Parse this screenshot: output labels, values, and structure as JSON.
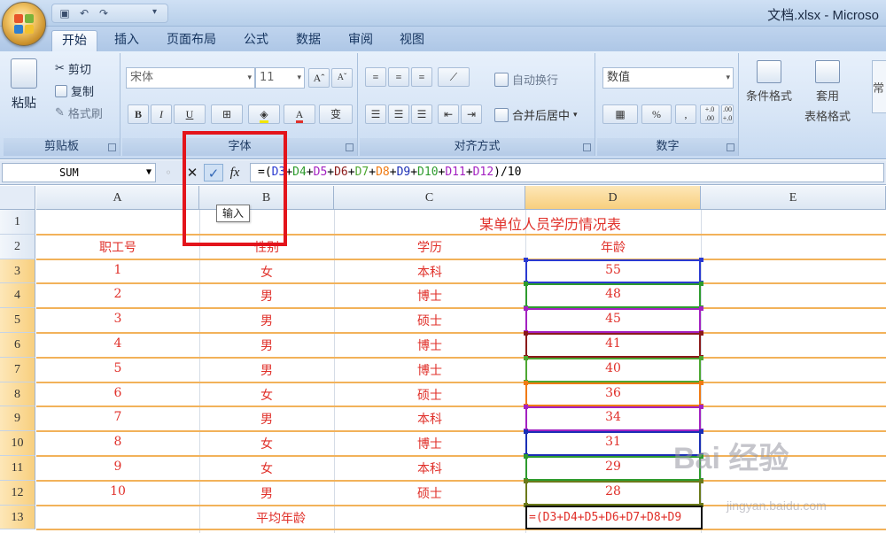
{
  "window": {
    "title": "文档.xlsx - Microso"
  },
  "tabs": [
    "开始",
    "插入",
    "页面布局",
    "公式",
    "数据",
    "审阅",
    "视图"
  ],
  "clipboard": {
    "paste": "粘贴",
    "cut": "剪切",
    "copy": "复制",
    "format_painter": "格式刷",
    "label": "剪贴板"
  },
  "font": {
    "name": "宋体",
    "size": "11",
    "grow": "A",
    "shrink": "A",
    "bold": "B",
    "italic": "I",
    "underline": "U",
    "label": "字体",
    "phonetic": "变"
  },
  "alignment": {
    "wrap": "自动换行",
    "merge": "合并后居中",
    "label": "对齐方式"
  },
  "number": {
    "format": "数值",
    "percent": "%",
    "comma": ",",
    "inc": "+.0 .00",
    "dec": ".00 +.0",
    "label": "数字"
  },
  "styles": {
    "cond": "条件格式",
    "table": "套用",
    "table2": "表格格式",
    "cell": "常"
  },
  "formula_bar": {
    "name_box": "SUM",
    "cancel": "✕",
    "enter": "✓",
    "fx": "fx",
    "formula_parts": [
      {
        "t": "=(",
        "c": "#000000"
      },
      {
        "t": "D3",
        "c": "#2a3ad1"
      },
      {
        "t": "+",
        "c": "#000000"
      },
      {
        "t": "D4",
        "c": "#2e9b2e"
      },
      {
        "t": "+",
        "c": "#000000"
      },
      {
        "t": "D5",
        "c": "#a321c1"
      },
      {
        "t": "+",
        "c": "#000000"
      },
      {
        "t": "D6",
        "c": "#8b1a1a"
      },
      {
        "t": "+",
        "c": "#000000"
      },
      {
        "t": "D7",
        "c": "#4da732"
      },
      {
        "t": "+",
        "c": "#000000"
      },
      {
        "t": "D8",
        "c": "#f07a12"
      },
      {
        "t": "+",
        "c": "#000000"
      },
      {
        "t": "D9",
        "c": "#1b2fb5"
      },
      {
        "t": "+",
        "c": "#000000"
      },
      {
        "t": "D10",
        "c": "#2e9b2e"
      },
      {
        "t": "+",
        "c": "#000000"
      },
      {
        "t": "D11",
        "c": "#a321c1"
      },
      {
        "t": "+",
        "c": "#000000"
      },
      {
        "t": "D12",
        "c": "#a321c1"
      },
      {
        "t": ")/10",
        "c": "#000000"
      }
    ]
  },
  "tooltip": "输入",
  "columns": [
    "A",
    "B",
    "C",
    "D",
    "E"
  ],
  "rows": [
    "1",
    "2",
    "3",
    "4",
    "5",
    "6",
    "7",
    "8",
    "9",
    "10",
    "11",
    "12",
    "13"
  ],
  "sheet": {
    "title": "某单位人员学历情况表",
    "headers": [
      "职工号",
      "性别",
      "学历",
      "年龄"
    ],
    "records": [
      [
        "1",
        "女",
        "本科",
        "55"
      ],
      [
        "2",
        "男",
        "博士",
        "48"
      ],
      [
        "3",
        "男",
        "硕士",
        "45"
      ],
      [
        "4",
        "男",
        "博士",
        "41"
      ],
      [
        "5",
        "男",
        "博士",
        "40"
      ],
      [
        "6",
        "女",
        "硕士",
        "36"
      ],
      [
        "7",
        "男",
        "本科",
        "34"
      ],
      [
        "8",
        "女",
        "博士",
        "31"
      ],
      [
        "9",
        "女",
        "本科",
        "29"
      ],
      [
        "10",
        "男",
        "硕士",
        "28"
      ]
    ],
    "avg_label": "平均年龄",
    "editing_cell": "=(D3+D4+D5+D6+D7+D8+D9"
  },
  "ref_colors": [
    "#2a3ad1",
    "#2e9b2e",
    "#a321c1",
    "#8b1a1a",
    "#4da732",
    "#f07a12",
    "#a321c1",
    "#1b2fb5",
    "#2e9b2e",
    "#6b7a1a"
  ],
  "watermark": {
    "main": "Bai 经验",
    "sub": "jingyan.baidu.com"
  }
}
